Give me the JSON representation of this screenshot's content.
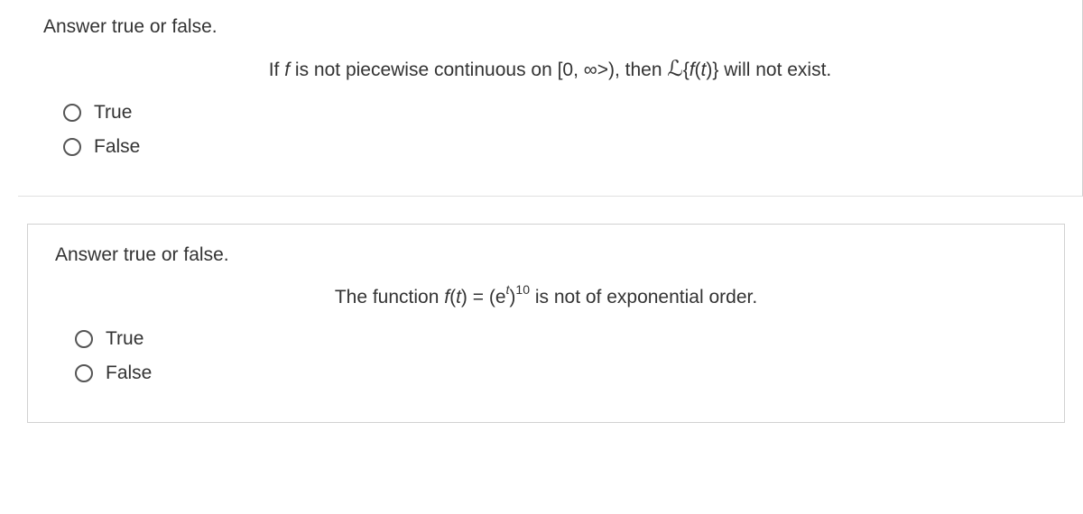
{
  "q1": {
    "prompt": "Answer true or false.",
    "statement_prefix": "If ",
    "statement_var1": "f",
    "statement_mid1": " is not piecewise continuous on [0, ∞>), then ",
    "statement_laplace": "ℒ",
    "statement_brace_open": "{",
    "statement_var2": "f",
    "statement_paren": "(",
    "statement_var3": "t",
    "statement_close": ")} will not exist.",
    "options": {
      "true": "True",
      "false": "False"
    }
  },
  "q2": {
    "prompt": "Answer true or false.",
    "statement_prefix": "The function ",
    "func_f": "f",
    "paren_open": "(",
    "func_t": "t",
    "paren_close_eq": ") = (e",
    "sup_t": "t",
    "close_paren": ")",
    "sup_10": "10",
    "statement_suffix": " is not of exponential order.",
    "options": {
      "true": "True",
      "false": "False"
    }
  }
}
